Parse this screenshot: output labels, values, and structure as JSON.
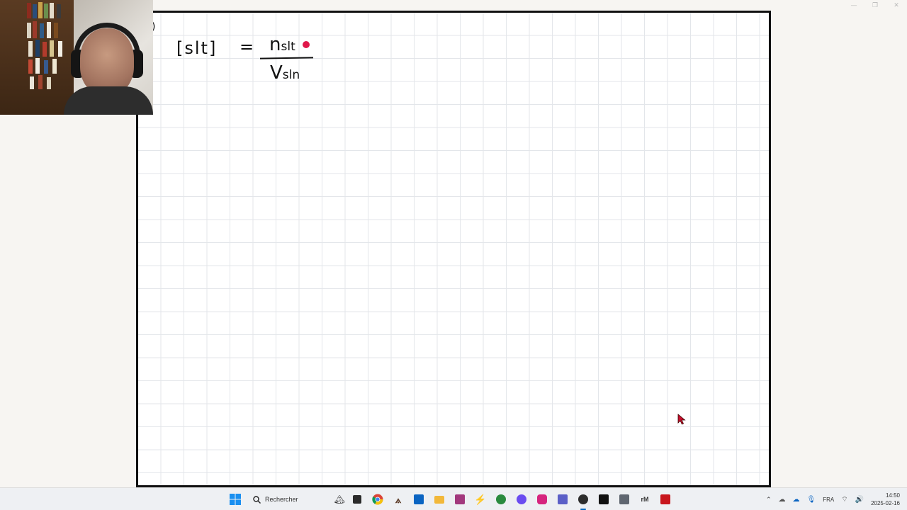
{
  "window": {
    "minimize_glyph": "—",
    "restore_glyph": "❐",
    "close_glyph": "✕"
  },
  "whiteboard": {
    "formula_lhs": "[slt]",
    "equals": "=",
    "numerator": "n",
    "numerator_sub": "slt",
    "denominator": "V",
    "denominator_sub": "sln",
    "partial_glyph": ")"
  },
  "taskbar": {
    "search_placeholder": "Rechercher",
    "language": "FRA",
    "time": "14:50",
    "date": "2025-02-16",
    "apps": [
      "windows-start",
      "search",
      "widgets",
      "file-explorer",
      "chrome",
      "affinity",
      "outlook",
      "folder",
      "deezer",
      "power-app",
      "xbox-app",
      "messenger",
      "instagram",
      "teams",
      "obs",
      "pycharm",
      "calculator",
      "remarkable",
      "acrobat"
    ]
  },
  "colors": {
    "accent": "#0067c0",
    "canvas_border": "#111111",
    "grid_line": "#e3e6ea",
    "ink": "#111111",
    "pen_marker": "#e0174a",
    "cursor": "#c8102e"
  }
}
